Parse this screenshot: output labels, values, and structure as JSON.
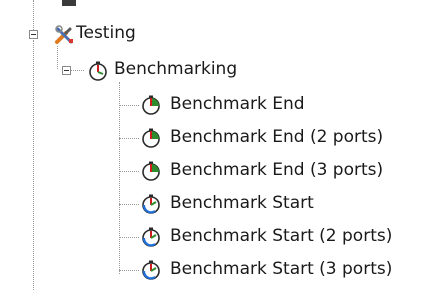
{
  "tree": {
    "partial_top_label": "",
    "category": {
      "label": "Testing",
      "icon": "tools-icon",
      "expanded": true,
      "folder": {
        "label": "Benchmarking",
        "icon": "benchmark-folder-icon",
        "expanded": true,
        "items": [
          {
            "label": "Benchmark End",
            "icon": "benchmark-end-icon"
          },
          {
            "label": "Benchmark End (2 ports)",
            "icon": "benchmark-end-icon"
          },
          {
            "label": "Benchmark End (3 ports)",
            "icon": "benchmark-end-icon"
          },
          {
            "label": "Benchmark Start",
            "icon": "benchmark-start-icon"
          },
          {
            "label": "Benchmark Start (2 ports)",
            "icon": "benchmark-start-icon"
          },
          {
            "label": "Benchmark Start (3 ports)",
            "icon": "benchmark-start-icon"
          }
        ]
      }
    }
  },
  "colors": {
    "end_accent": "#2e8b2e",
    "start_accent": "#1e6fd9",
    "folder_accent": "#d11c1c",
    "tools_orange": "#e07a1f"
  }
}
